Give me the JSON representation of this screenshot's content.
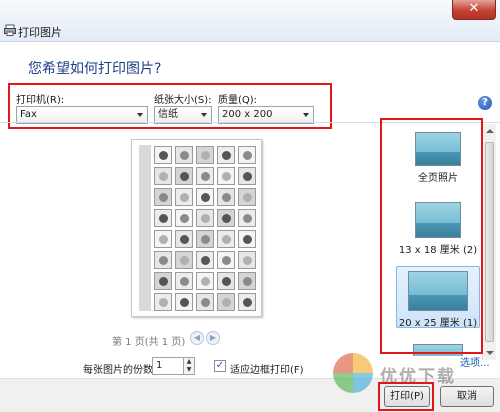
{
  "window": {
    "title": "打印图片",
    "close_glyph": "✕"
  },
  "heading": "您希望如何打印图片?",
  "printer": {
    "label": "打印机(R):",
    "value": "Fax"
  },
  "paper_size": {
    "label": "纸张大小(S):",
    "value": "信纸"
  },
  "quality": {
    "label": "质量(Q):",
    "value": "200 x 200"
  },
  "help_glyph": "?",
  "preview": {
    "page_info": "第 1 页(共 1 页)",
    "prev_glyph": "◀",
    "next_glyph": "▶"
  },
  "layouts": [
    {
      "label": "全页照片",
      "selected": false
    },
    {
      "label": "13 x 18 厘米 (2)",
      "selected": false
    },
    {
      "label": "20 x 25 厘米 (1)",
      "selected": true
    },
    {
      "label": "",
      "selected": false
    }
  ],
  "copies": {
    "label": "每张图片的份数(C):",
    "value": "1"
  },
  "fit": {
    "label": "适应边框打印(F)",
    "checked": true,
    "check_glyph": "✓"
  },
  "options_link": "选项...",
  "buttons": {
    "print": "打印(P)",
    "cancel": "取消"
  },
  "watermark": "优优下载",
  "colors": {
    "annotation_red": "#e0161a",
    "heading_blue": "#1e3f8a",
    "link_blue": "#1e57b3"
  }
}
